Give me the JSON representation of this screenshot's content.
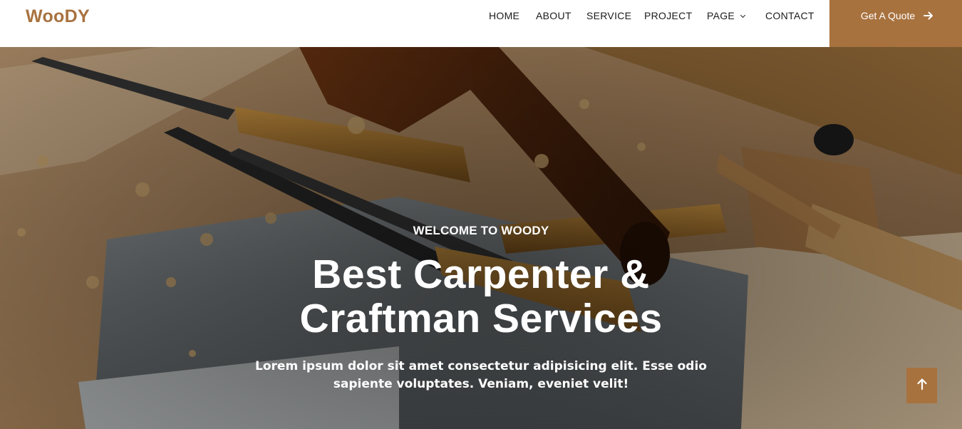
{
  "brand": {
    "name": "WooDY",
    "accent": "#A8723F"
  },
  "nav": {
    "items": [
      {
        "label": "HOME"
      },
      {
        "label": "ABOUT"
      },
      {
        "label": "SERVICE"
      },
      {
        "label": "PROJECT"
      },
      {
        "label": "PAGE",
        "has_dropdown": true
      },
      {
        "label": "CONTACT"
      }
    ]
  },
  "cta": {
    "label": "Get A Quote",
    "icon": "arrow-right-icon"
  },
  "hero": {
    "subtitle": "WELCOME TO WOODY",
    "title_line1": "Best Carpenter &",
    "title_line2": "Craftman Services",
    "lead_line1": "Lorem ipsum dolor sit amet consectetur adipisicing elit. Esse odio",
    "lead_line2": "sapiente voluptates. Veniam, eveniet velit!"
  },
  "back_to_top": {
    "icon": "arrow-up-icon"
  }
}
